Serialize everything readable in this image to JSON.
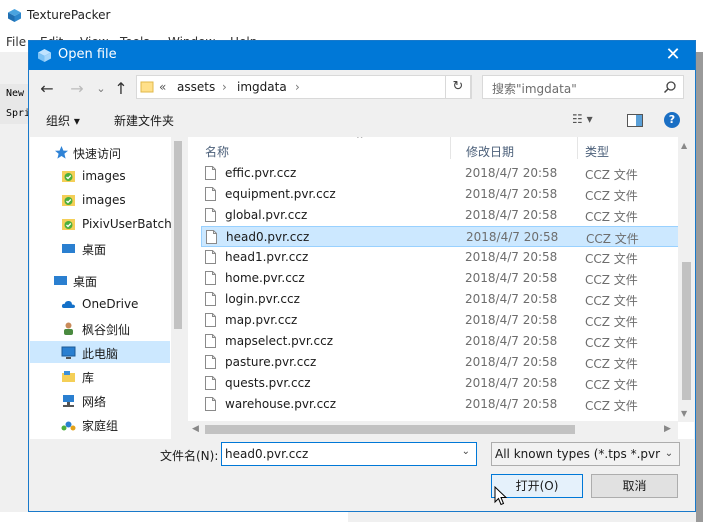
{
  "app": {
    "title": "TexturePacker",
    "menu": [
      "File",
      "Edit",
      "View",
      "Tools",
      "Window",
      "Help"
    ],
    "toolbar_fragments": [
      "New",
      "Spri"
    ]
  },
  "dialog": {
    "title": "Open file",
    "close_glyph": "✕",
    "nav": {
      "back": "←",
      "forward": "→",
      "dropdown": "⌄",
      "up": "↑"
    },
    "address": {
      "overflow": "«",
      "segments": [
        "assets",
        "imgdata"
      ],
      "separator": "›",
      "dropdown": "⌄"
    },
    "refresh_glyph": "↻",
    "search_placeholder": "搜索\"imgdata\"",
    "commands": {
      "organize": "组织 ▾",
      "new_folder": "新建文件夹",
      "view_glyph": "☷ ▾",
      "help_glyph": "?"
    },
    "nav_pane": [
      {
        "label": "快速访问",
        "icon": "star-icon",
        "indent": 0
      },
      {
        "label": "images",
        "icon": "pinned-folder-icon",
        "indent": 1
      },
      {
        "label": "images",
        "icon": "pinned-folder-icon",
        "indent": 1
      },
      {
        "label": "PixivUserBatchl",
        "icon": "pinned-folder-icon",
        "indent": 1
      },
      {
        "label": "桌面",
        "icon": "desktop-icon",
        "indent": 1
      },
      {
        "label": "桌面",
        "icon": "desktop-icon",
        "indent": 0
      },
      {
        "label": "OneDrive",
        "icon": "cloud-icon",
        "indent": 1
      },
      {
        "label": "枫谷剑仙",
        "icon": "user-icon",
        "indent": 1
      },
      {
        "label": "此电脑",
        "icon": "computer-icon",
        "indent": 1,
        "selected": true
      },
      {
        "label": "库",
        "icon": "library-icon",
        "indent": 1
      },
      {
        "label": "网络",
        "icon": "network-icon",
        "indent": 1
      },
      {
        "label": "家庭组",
        "icon": "homegroup-icon",
        "indent": 1
      }
    ],
    "columns": {
      "name": "名称",
      "date": "修改日期",
      "type": "类型"
    },
    "files": [
      {
        "name": "effic.pvr.ccz",
        "date": "2018/4/7 20:58",
        "type": "CCZ 文件"
      },
      {
        "name": "equipment.pvr.ccz",
        "date": "2018/4/7 20:58",
        "type": "CCZ 文件"
      },
      {
        "name": "global.pvr.ccz",
        "date": "2018/4/7 20:58",
        "type": "CCZ 文件"
      },
      {
        "name": "head0.pvr.ccz",
        "date": "2018/4/7 20:58",
        "type": "CCZ 文件",
        "selected": true
      },
      {
        "name": "head1.pvr.ccz",
        "date": "2018/4/7 20:58",
        "type": "CCZ 文件"
      },
      {
        "name": "home.pvr.ccz",
        "date": "2018/4/7 20:58",
        "type": "CCZ 文件"
      },
      {
        "name": "login.pvr.ccz",
        "date": "2018/4/7 20:58",
        "type": "CCZ 文件"
      },
      {
        "name": "map.pvr.ccz",
        "date": "2018/4/7 20:58",
        "type": "CCZ 文件"
      },
      {
        "name": "mapselect.pvr.ccz",
        "date": "2018/4/7 20:58",
        "type": "CCZ 文件"
      },
      {
        "name": "pasture.pvr.ccz",
        "date": "2018/4/7 20:58",
        "type": "CCZ 文件"
      },
      {
        "name": "quests.pvr.ccz",
        "date": "2018/4/7 20:58",
        "type": "CCZ 文件"
      },
      {
        "name": "warehouse.pvr.ccz",
        "date": "2018/4/7 20:58",
        "type": "CCZ 文件"
      }
    ],
    "filename_label": "文件名(N):",
    "filename_value": "head0.pvr.ccz",
    "filename_dropdown": "⌄",
    "filter_value": "All known types (*.tps *.pvr *",
    "filter_dropdown": "⌄",
    "open_button": "打开(O)",
    "cancel_button": "取消",
    "colors": {
      "accent": "#0078d7",
      "selection": "#cce8ff"
    }
  }
}
